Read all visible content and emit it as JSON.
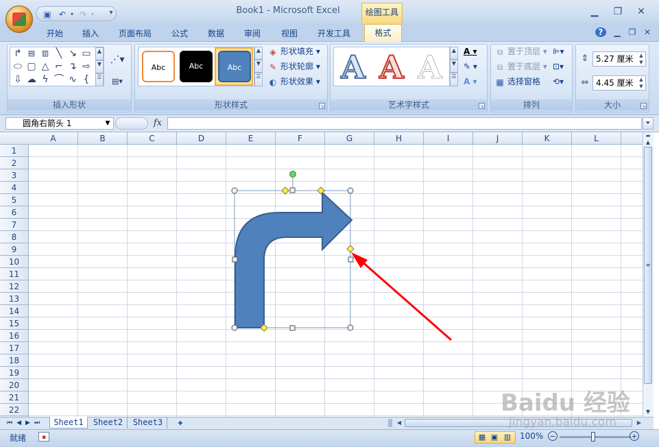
{
  "window": {
    "title": "Book1 - Microsoft Excel",
    "context_tab_group": "绘图工具"
  },
  "quick_access": {
    "save_icon": "save-icon",
    "undo_icon": "undo-icon",
    "redo_icon": "redo-icon",
    "customize_icon": "customize-icon"
  },
  "tabs": [
    {
      "label": "开始"
    },
    {
      "label": "插入"
    },
    {
      "label": "页面布局"
    },
    {
      "label": "公式"
    },
    {
      "label": "数据"
    },
    {
      "label": "审阅"
    },
    {
      "label": "视图"
    },
    {
      "label": "开发工具"
    },
    {
      "label": "格式",
      "active": true
    }
  ],
  "ribbon": {
    "insert_shapes": {
      "label": "插入形状"
    },
    "shape_styles": {
      "label": "形状样式",
      "style_previews": [
        "Abc",
        "Abc",
        "Abc"
      ],
      "fill": "形状填充",
      "outline": "形状轮廓",
      "effects": "形状效果"
    },
    "wordart": {
      "label": "艺术字样式",
      "preview": [
        "A",
        "A",
        "A"
      ]
    },
    "arrange": {
      "label": "排列",
      "bring_front": "置于顶层",
      "send_back": "置于底层",
      "selection_pane": "选择窗格"
    },
    "size": {
      "label": "大小",
      "height": "5.27 厘米",
      "width": "4.45 厘米"
    }
  },
  "formula_bar": {
    "name_box": "圆角右箭头 1",
    "fx": "fx",
    "value": ""
  },
  "grid": {
    "columns": [
      "A",
      "B",
      "C",
      "D",
      "E",
      "F",
      "G",
      "H",
      "I",
      "J",
      "K",
      "L"
    ],
    "rows": [
      "1",
      "2",
      "3",
      "4",
      "5",
      "6",
      "7",
      "8",
      "9",
      "10",
      "11",
      "12",
      "13",
      "14",
      "15",
      "16",
      "17",
      "18",
      "19",
      "20",
      "21",
      "22"
    ]
  },
  "sheets": [
    "Sheet1",
    "Sheet2",
    "Sheet3"
  ],
  "status": {
    "ready": "就绪",
    "zoom": "100%"
  },
  "watermark": {
    "brand": "Baidu 经验",
    "url": "jingyan.baidu.com"
  },
  "colors": {
    "arrow_fill": "#4f81bd",
    "arrow_outline": "#385d8a",
    "annotation_arrow": "#ff0000",
    "handle_yellow": "#ffee55",
    "rotate_handle": "#6cd06c"
  }
}
